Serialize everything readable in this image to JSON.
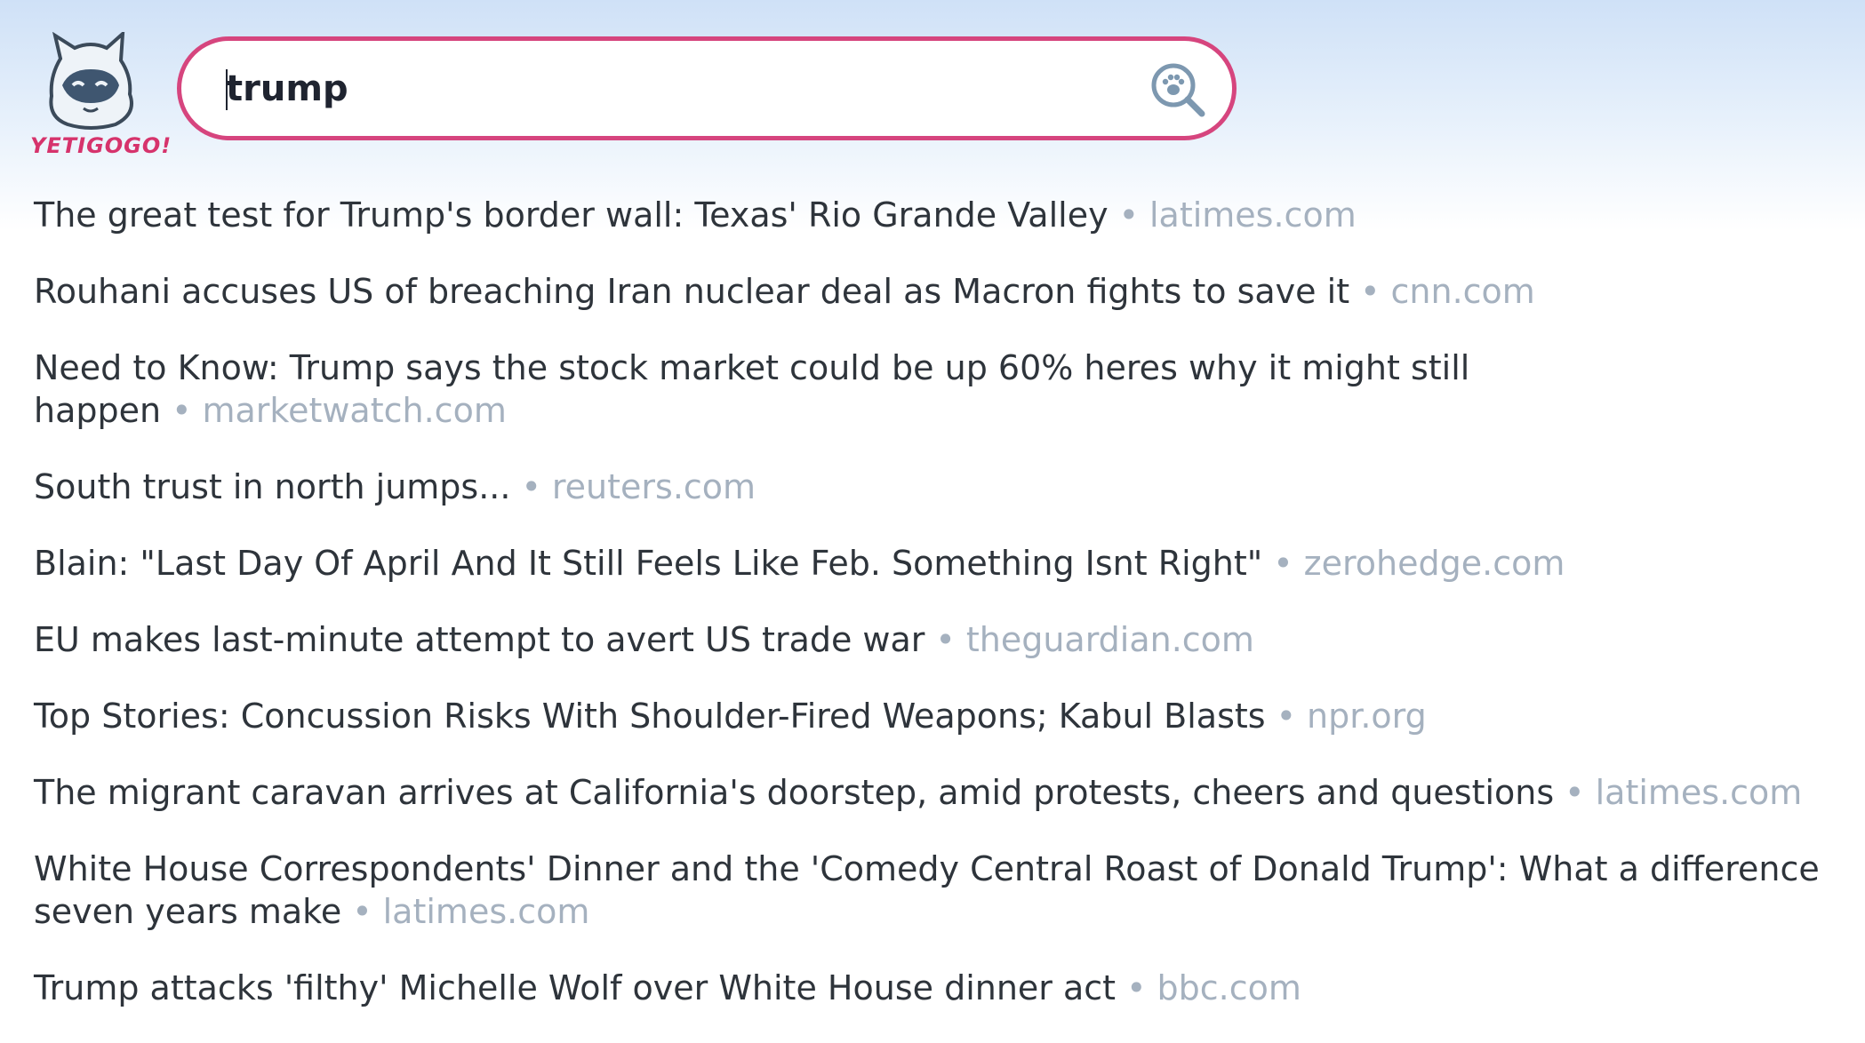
{
  "logo": {
    "text": "YETIGOGO!"
  },
  "search": {
    "value": "trump",
    "placeholder": ""
  },
  "separator": "•",
  "results": [
    {
      "title": "The great test for Trump's border wall: Texas' Rio Grande Valley",
      "source": "latimes.com"
    },
    {
      "title": "Rouhani accuses US of breaching Iran nuclear deal as Macron fights to save it",
      "source": "cnn.com"
    },
    {
      "title": "Need to Know: Trump says the stock market could be up 60% heres why it might still happen",
      "source": "marketwatch.com"
    },
    {
      "title": "South trust in north jumps...",
      "source": "reuters.com"
    },
    {
      "title": "Blain: \"Last Day Of April And It Still Feels Like Feb. Something Isnt Right\"",
      "source": "zerohedge.com"
    },
    {
      "title": "EU makes last-minute attempt to avert US trade war",
      "source": "theguardian.com"
    },
    {
      "title": "Top Stories: Concussion Risks With Shoulder-Fired Weapons; Kabul Blasts",
      "source": "npr.org"
    },
    {
      "title": "The migrant caravan arrives at California's doorstep, amid protests, cheers and questions",
      "source": "latimes.com"
    },
    {
      "title": "White House Correspondents' Dinner and the 'Comedy Central Roast of Donald Trump': What a difference seven years make",
      "source": "latimes.com"
    },
    {
      "title": "Trump attacks 'filthy' Michelle Wolf over White House dinner act",
      "source": "bbc.com"
    }
  ],
  "colors": {
    "accent": "#d6457e",
    "source": "#a5b1bf",
    "text": "#2e343b",
    "logo_text": "#d6336c"
  },
  "icons": {
    "logo": "yeti-mascot-icon",
    "search": "paw-magnifier-icon"
  }
}
